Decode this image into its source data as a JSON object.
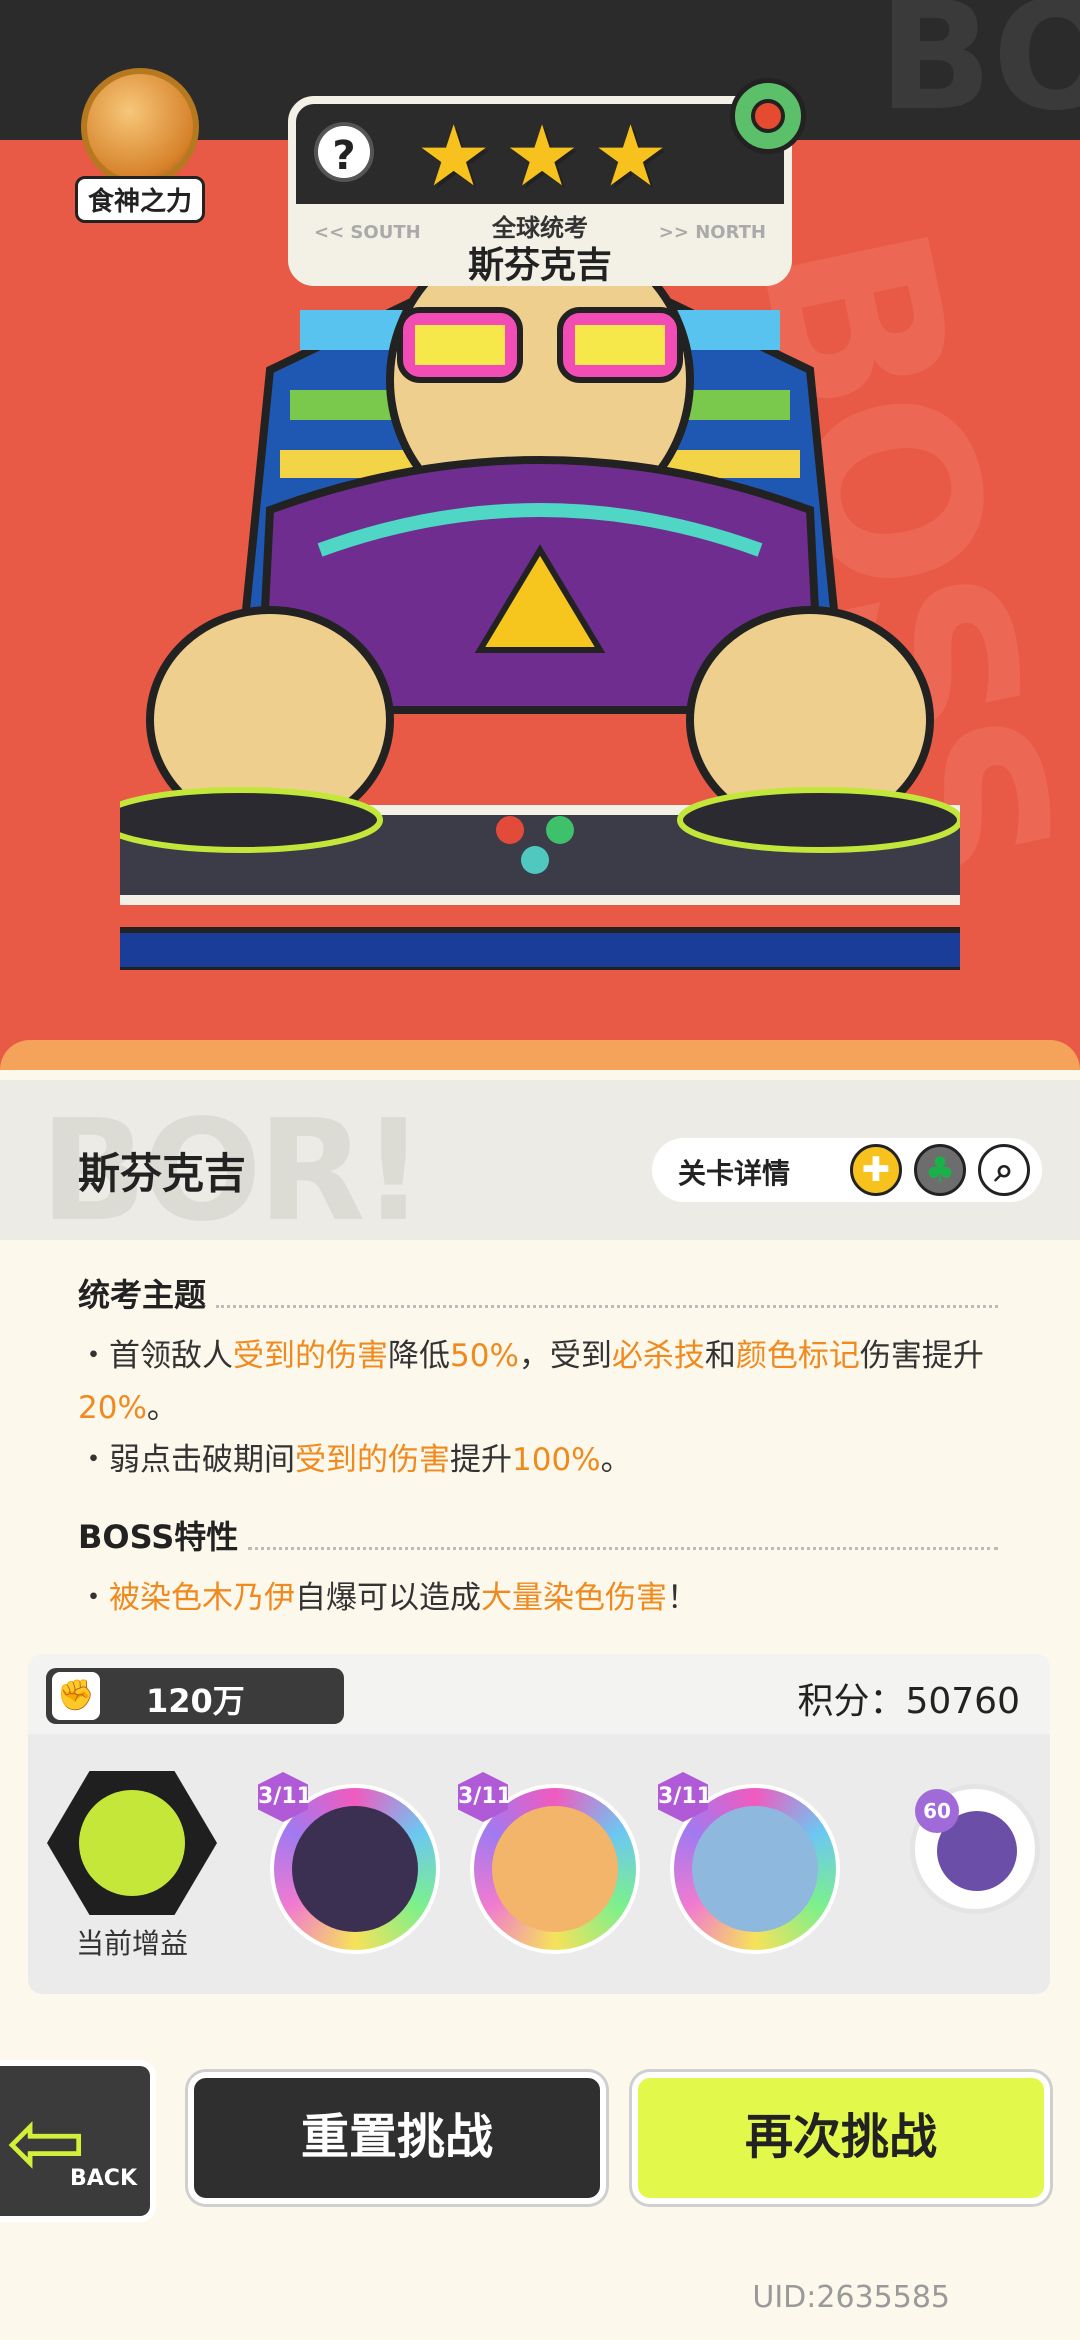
{
  "hero": {
    "power_badge_label": "食神之力",
    "stars": [
      "★",
      "★",
      "★"
    ],
    "help_icon": "?",
    "exam_label": "全球统考",
    "boss_title": "斯芬克吉",
    "direction_left": "<< SOUTH",
    "direction_right": ">> NORTH"
  },
  "boss_header": {
    "name": "斯芬克吉",
    "detail_label": "关卡详情"
  },
  "theme": {
    "title": "统考主题",
    "rules": [
      {
        "segments": [
          {
            "text": "・首领敌人",
            "hl": false
          },
          {
            "text": "受到的伤害",
            "hl": true
          },
          {
            "text": "降低",
            "hl": false
          },
          {
            "text": "50%",
            "hl": true
          },
          {
            "text": "，受到",
            "hl": false
          },
          {
            "text": "必杀技",
            "hl": true
          },
          {
            "text": "和",
            "hl": false
          },
          {
            "text": "颜色标记",
            "hl": true
          },
          {
            "text": "伤害提升",
            "hl": false
          },
          {
            "text": "20%",
            "hl": true
          },
          {
            "text": "。",
            "hl": false
          }
        ]
      },
      {
        "segments": [
          {
            "text": "・弱点击破期间",
            "hl": false
          },
          {
            "text": "受到的伤害",
            "hl": true
          },
          {
            "text": "提升",
            "hl": false
          },
          {
            "text": "100%",
            "hl": true
          },
          {
            "text": "。",
            "hl": false
          }
        ]
      }
    ]
  },
  "boss_trait": {
    "title": "BOSS特性",
    "rules": [
      {
        "segments": [
          {
            "text": "・",
            "hl": false
          },
          {
            "text": "被染色木乃伊",
            "hl": true
          },
          {
            "text": "自爆可以造成",
            "hl": false
          },
          {
            "text": "大量染色伤害",
            "hl": true
          },
          {
            "text": "！",
            "hl": false
          }
        ]
      }
    ]
  },
  "team": {
    "power_value": "120万",
    "score_text": "积分：50760",
    "buff_label": "当前增益",
    "heroes": [
      {
        "level": "3/11",
        "face": "#3b2f52"
      },
      {
        "level": "3/11",
        "face": "#f2b56a"
      },
      {
        "level": "3/11",
        "face": "#8fb8df"
      }
    ],
    "pet_level": "60"
  },
  "buttons": {
    "back": "BACK",
    "reset": "重置挑战",
    "retry": "再次挑战"
  },
  "uid": "UID:2635585",
  "colors": {
    "accent_orange": "#f08a1e",
    "hero_red": "#e85a45",
    "retry_yellow": "#e2f84a"
  }
}
